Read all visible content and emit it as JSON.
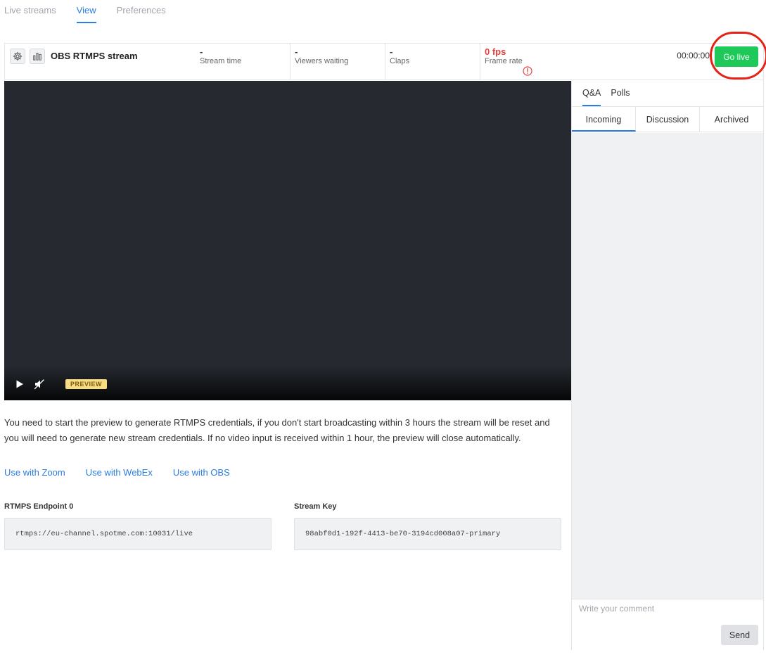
{
  "nav": {
    "tabs": [
      "Live streams",
      "View",
      "Preferences"
    ],
    "active": "View"
  },
  "stream": {
    "title": "OBS RTMPS stream",
    "timer": "00:00:00",
    "go_live_label": "Go live",
    "stats": [
      {
        "value": "-",
        "label": "Stream time"
      },
      {
        "value": "-",
        "label": "Viewers waiting"
      },
      {
        "value": "-",
        "label": "Claps"
      },
      {
        "value": "0 fps",
        "label": "Frame rate"
      }
    ],
    "icons": {
      "settings": "gear-icon",
      "analytics": "bar-chart-icon",
      "warning": "exclamation-circle-icon"
    }
  },
  "player": {
    "badge": "PREVIEW",
    "icons": {
      "play": "play-icon",
      "mute": "muted-speaker-icon"
    }
  },
  "info": {
    "text": "You need to start the preview to generate RTMPS credentials, if you don't start broadcasting within 3 hours the stream will be reset and you will need to generate new stream credentials. If no video input is received within 1 hour, the preview will close automatically."
  },
  "links": [
    "Use with Zoom",
    "Use with WebEx",
    "Use with OBS"
  ],
  "credentials": {
    "endpoint_label": "RTMPS Endpoint 0",
    "endpoint_value": "rtmps://eu-channel.spotme.com:10031/live",
    "key_label": "Stream Key",
    "key_value": "98abf0d1-192f-4413-be70-3194cd008a07-primary"
  },
  "side_panel": {
    "tabs": [
      "Q&A",
      "Polls"
    ],
    "sub_tabs": [
      "Incoming",
      "Discussion",
      "Archived"
    ],
    "comment_placeholder": "Write your comment",
    "send_label": "Send"
  },
  "colors": {
    "accent": "#2a7de1",
    "go_live": "#1ec95a",
    "alert": "#e5413b",
    "highlight_ring": "#e42419",
    "video_bg": "#262a30"
  }
}
